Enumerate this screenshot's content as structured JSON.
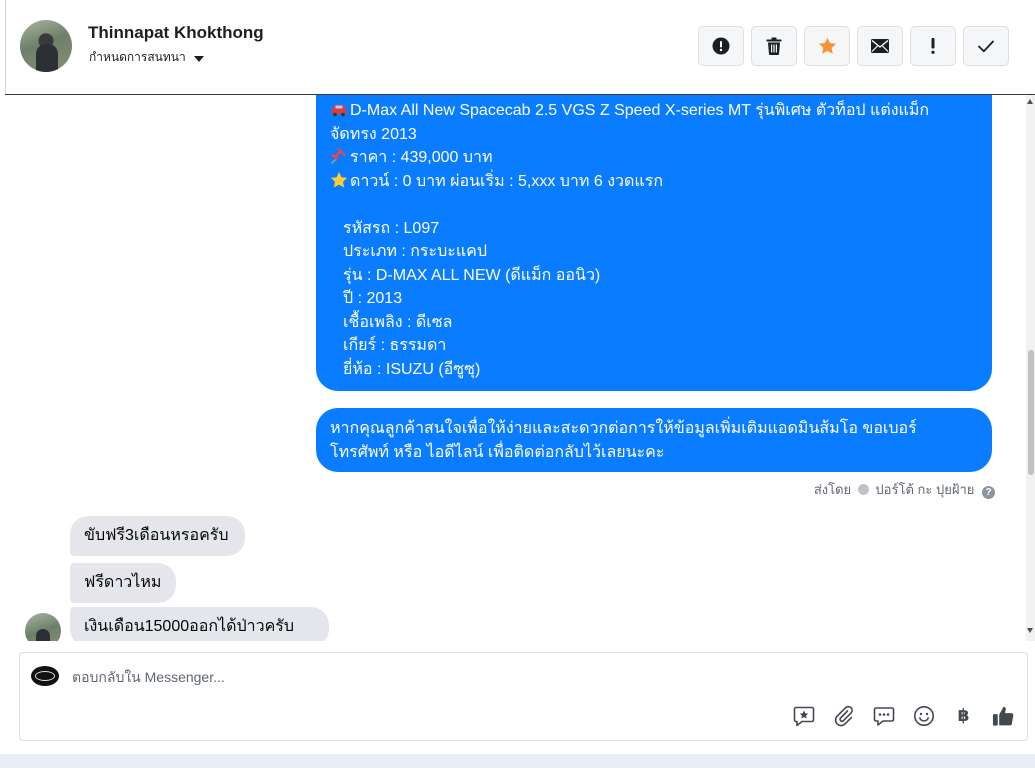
{
  "header": {
    "user_name": "Thinnapat Khokthong",
    "assign_label": "กำหนดการสนทนา",
    "actions": [
      {
        "name": "mark-spam",
        "icon": "alert-circle-icon"
      },
      {
        "name": "delete",
        "icon": "trash-icon"
      },
      {
        "name": "star",
        "icon": "star-icon",
        "color": "#f7923b"
      },
      {
        "name": "mark-unread",
        "icon": "envelope-icon"
      },
      {
        "name": "follow-up",
        "icon": "exclamation-icon"
      },
      {
        "name": "done",
        "icon": "check-icon"
      }
    ]
  },
  "messages": {
    "outgoing_1": {
      "line_1": "D-Max All New Spacecab 2.5 VGS Z Speed X-series MT รุ่นพิเศษ ตัวท็อป แต่งแม็ก",
      "line_2": "จัดทรง 2013",
      "price": "ราคา : 439,000 บาท",
      "down": "ดาวน์ : 0 บาท ผ่อนเริ่ม : 5,xxx บาท 6 งวดแรก",
      "code": "รหัสรถ : L097",
      "type": "ประเภท : กระบะแคป",
      "model": "รุ่น : D-MAX ALL NEW (ดีแม็ก ออนิว)",
      "year": "ปี : 2013",
      "fuel": "เชื้อเพลิง : ดีเซล",
      "gear": "เกียร์ : ธรรมดา",
      "brand": "ยี่ห้อ : ISUZU (อีซูซุ)"
    },
    "outgoing_2": {
      "line_1": "หากคุณลูกค้าสนใจเพื่อให้ง่ายและสะดวกต่อการให้ข้อมูลเพิ่มเติมแอดมินส้มโอ ขอเบอร์",
      "line_2": "โทรศัพท์ หรือ ไอดีไลน์ เพื่อติดต่อกลับไว้เลยนะคะ"
    },
    "sent_by_label": "ส่งโดย",
    "sent_by_name": "ปอร์โต้ กะ ปุยฝ้าย",
    "help_glyph": "?",
    "incoming": [
      "ขับฟรี3เดือนหรอครับ",
      "ฟรีดาวไหม",
      "เงินเดือน15000ออกได้ป่าวครับ"
    ]
  },
  "composer": {
    "placeholder": "ตอบกลับใน Messenger...",
    "baht_symbol": "฿",
    "tools": [
      "saved-reply-icon",
      "attachment-icon",
      "chat-icon",
      "emoji-icon",
      "baht-icon",
      "thumbs-up-icon"
    ]
  },
  "colors": {
    "outgoing_bubble": "#0a7cff",
    "incoming_bubble": "#e4e6eb",
    "star": "#f7923b"
  }
}
